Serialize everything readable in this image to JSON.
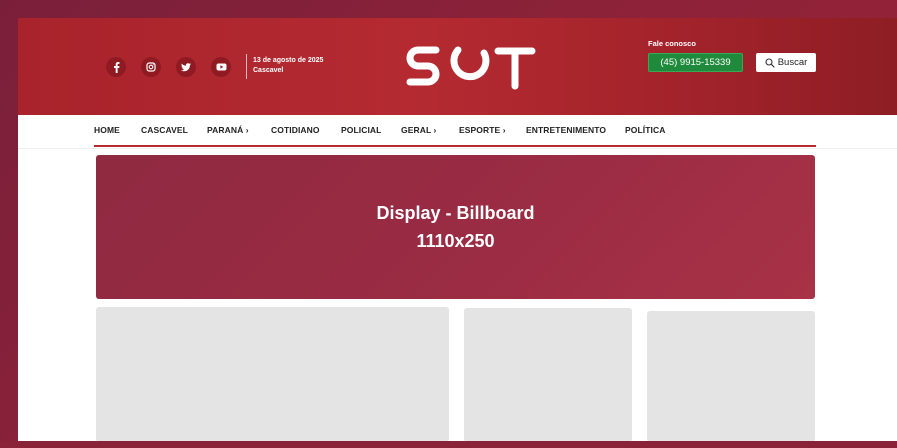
{
  "header": {
    "social": [
      {
        "name": "facebook",
        "icon": "facebook-icon"
      },
      {
        "name": "instagram",
        "icon": "instagram-icon"
      },
      {
        "name": "twitter",
        "icon": "twitter-icon"
      },
      {
        "name": "youtube",
        "icon": "youtube-icon"
      }
    ],
    "date": "13 de agosto de 2025",
    "city": "Cascavel",
    "logo_text": "SOT",
    "contact_label": "Fale conosco",
    "phone": "(45) 9915-15339",
    "search_label": "Buscar"
  },
  "nav": {
    "items": [
      {
        "label": "HOME"
      },
      {
        "label": "CASCAVEL"
      },
      {
        "label": "PARANÁ ›"
      },
      {
        "label": "COTIDIANO"
      },
      {
        "label": "POLICIAL"
      },
      {
        "label": "GERAL ›"
      },
      {
        "label": "ESPORTE ›"
      },
      {
        "label": "ENTRETENIMENTO"
      },
      {
        "label": "POLÍTICA"
      }
    ]
  },
  "billboard": {
    "line1": "Display - Billboard",
    "line2": "1110x250"
  },
  "colors": {
    "brand_red": "#b52a31",
    "phone_green": "#1f8a3b",
    "billboard": "#992b43",
    "placeholder": "#e4e4e4"
  }
}
